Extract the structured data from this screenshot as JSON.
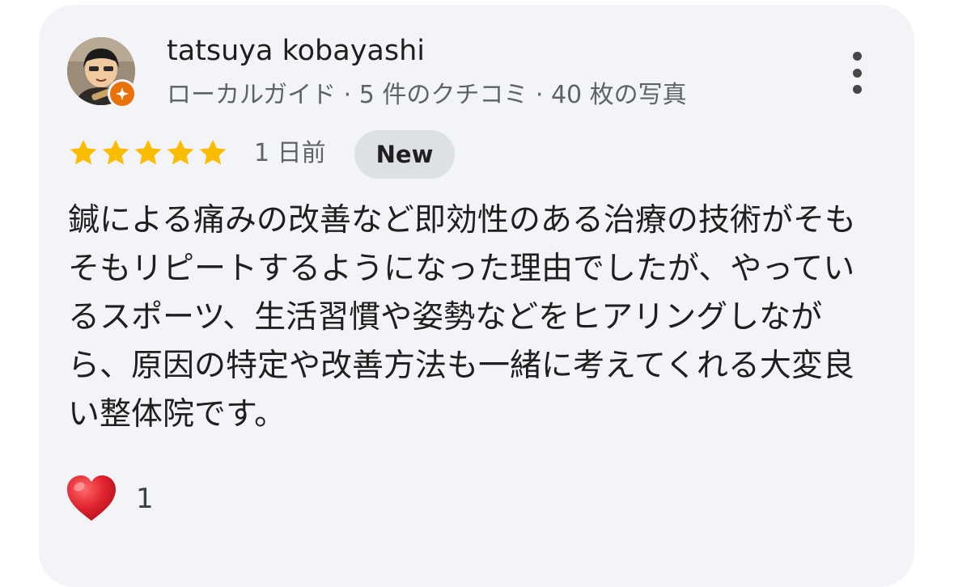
{
  "reviewer": {
    "name": "tatsuya kobayashi",
    "meta": "ローカルガイド · 5 件のクチコミ · 40 枚の写真",
    "avatar_icon": "user-avatar-photo",
    "badge_icon": "local-guide-badge-icon"
  },
  "review": {
    "rating": 5,
    "max_rating": 5,
    "date": "1 日前",
    "new_label": "New",
    "text": "鍼による痛みの改善など即効性のある治療の技術がそもそもリピートするようになった理由でしたが、やっているスポーツ、生活習慣や姿勢などをヒアリングしながら、原因の特定や改善方法も一緒に考えてくれる大変良い整体院です。"
  },
  "reactions": {
    "icon": "heart-icon",
    "count": "1"
  },
  "colors": {
    "card_bg": "#f3f4f7",
    "star": "#fbbc04",
    "badge_orange": "#e8710a",
    "heart": "#e0242f",
    "new_badge_bg": "#dde0e4"
  }
}
